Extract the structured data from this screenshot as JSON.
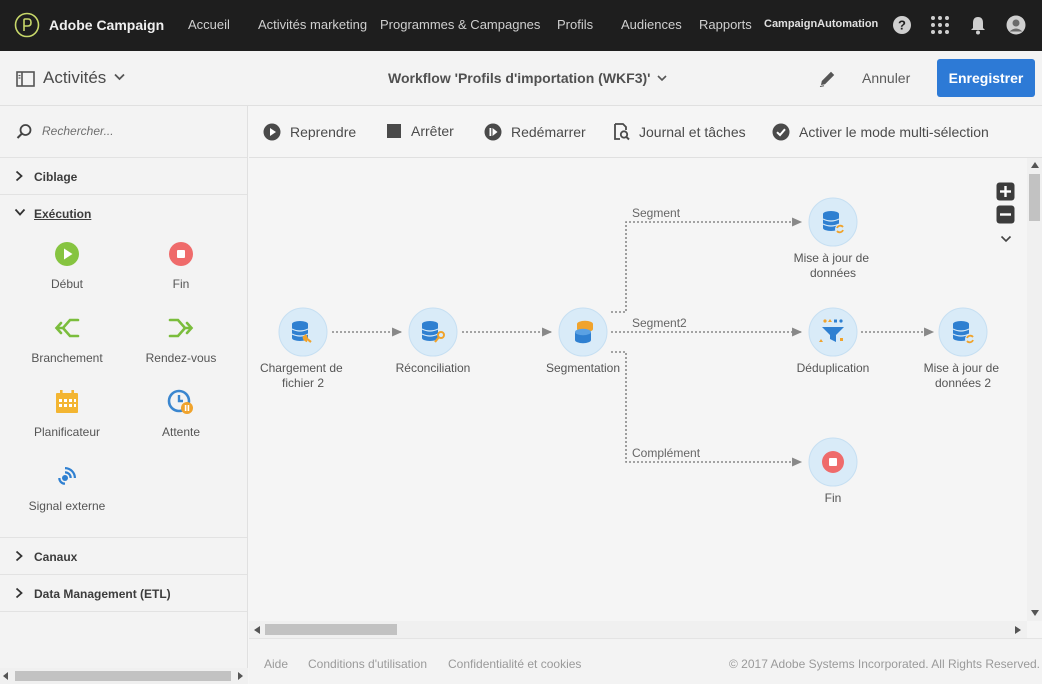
{
  "app": {
    "name": "Adobe Campaign"
  },
  "nav": {
    "items": [
      "Accueil",
      "Activités marketing",
      "Programmes & Campagnes",
      "Profils",
      "Audiences",
      "Rapports"
    ],
    "org": "CampaignAutomation"
  },
  "header": {
    "activities_label": "Activités",
    "workflow_title": "Workflow 'Profils d'importation (WKF3)'",
    "cancel": "Annuler",
    "save": "Enregistrer"
  },
  "sidebar": {
    "search_placeholder": "Rechercher...",
    "categories": {
      "targeting": "Ciblage",
      "execution": "Exécution",
      "channels": "Canaux",
      "data_management": "Data Management (ETL)"
    },
    "execution_items": [
      "Début",
      "Fin",
      "Branchement",
      "Rendez-vous",
      "Planificateur",
      "Attente",
      "Signal externe"
    ]
  },
  "toolbar": {
    "resume": "Reprendre",
    "stop": "Arrêter",
    "restart": "Redémarrer",
    "log": "Journal et tâches",
    "multiselect": "Activer le mode multi-sélection"
  },
  "workflow": {
    "nodes": {
      "load": [
        "Chargement de",
        "fichier 2"
      ],
      "reconcile": [
        "Réconciliation"
      ],
      "segmentation": [
        "Segmentation"
      ],
      "update1": [
        "Mise à jour de",
        "données"
      ],
      "dedup": [
        "Déduplication"
      ],
      "update2": [
        "Mise à jour de",
        "données 2"
      ],
      "end": [
        "Fin"
      ]
    },
    "transitions": {
      "segment": "Segment",
      "segment2": "Segment2",
      "complement": "Complément"
    }
  },
  "footer": {
    "help": "Aide",
    "terms": "Conditions d'utilisation",
    "privacy": "Confidentialité et cookies",
    "copyright": "© 2017 Adobe Systems Incorporated. All Rights Reserved."
  },
  "colors": {
    "nav_bg": "#1e1e1e",
    "primary": "#2d7ad6",
    "node_bg": "#d9ebf8",
    "db_blue": "#2f80d1",
    "accent_orange": "#f0a32c",
    "green": "#86c440",
    "red": "#ef6b6b"
  }
}
